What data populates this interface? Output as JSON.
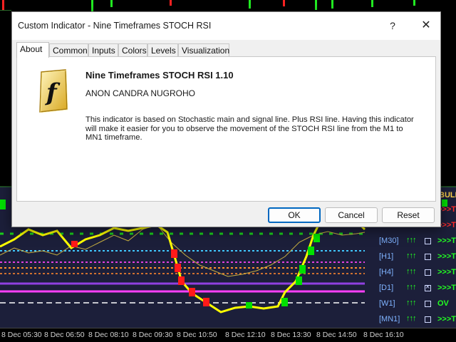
{
  "dialog": {
    "title": "Custom Indicator - Nine Timeframes STOCH RSI",
    "help_glyph": "?",
    "close_glyph": "✕",
    "tabs": [
      {
        "label": "About",
        "active": true
      },
      {
        "label": "Common",
        "active": false
      },
      {
        "label": "Inputs",
        "active": false
      },
      {
        "label": "Colors",
        "active": false
      },
      {
        "label": "Levels",
        "active": false
      },
      {
        "label": "Visualization",
        "active": false
      }
    ],
    "about": {
      "logo_letter": "f",
      "title": "Nine Timeframes STOCH RSI 1.10",
      "author": "ANON CANDRA NUGROHO",
      "description": "This indicator is based on Stochastic main and signal line. Plus RSI line. Having this indicator will make it easier for you to observe the movement of the STOCH RSI line from the M1 to MN1 timeframe."
    },
    "buttons": {
      "ok": "OK",
      "cancel": "Cancel",
      "reset": "Reset"
    }
  },
  "chart": {
    "time_labels": [
      "8 Dec 05:30",
      "8 Dec 06:50",
      "8 Dec 08:10",
      "8 Dec 09:30",
      "8 Dec 10:50",
      "8 Dec 12:10",
      "8 Dec 13:30",
      "8 Dec 14:50",
      "8 Dec 16:10"
    ],
    "panel_header": "BULL",
    "timeframes": [
      {
        "name": "",
        "arrows": "",
        "checked": false,
        "signal": ">>>T",
        "signal_color": "#ff2a2a"
      },
      {
        "name": "",
        "arrows": "",
        "checked": false,
        "signal": ">>>T",
        "signal_color": "#ff2a2a"
      },
      {
        "name": "[M30]",
        "arrows": "↑↑↑",
        "checked": false,
        "signal": ">>>T",
        "signal_color": "#22ff22"
      },
      {
        "name": "[H1]",
        "arrows": "↑↑↑",
        "checked": false,
        "signal": ">>>T",
        "signal_color": "#22ff22"
      },
      {
        "name": "[H4]",
        "arrows": "↑↑↑",
        "checked": false,
        "signal": ">>>T",
        "signal_color": "#22ff22"
      },
      {
        "name": "[D1]",
        "arrows": "↑↑↑",
        "checked": true,
        "signal": ">>>T",
        "signal_color": "#22ff22"
      },
      {
        "name": "[W1]",
        "arrows": "↑↑↑",
        "checked": false,
        "signal": "OV",
        "signal_color": "#22ff22"
      },
      {
        "name": "[MN1]",
        "arrows": "↑↑↑",
        "checked": false,
        "signal": ">>>T",
        "signal_color": "#22ff22"
      }
    ],
    "colors": {
      "background": "#000000",
      "indicator_bg": "#1c1f3a",
      "stoch_line": "#ffff00",
      "up_block": "#00e000",
      "down_block": "#ff1a1a",
      "rsi_line": "#c8b040"
    }
  }
}
